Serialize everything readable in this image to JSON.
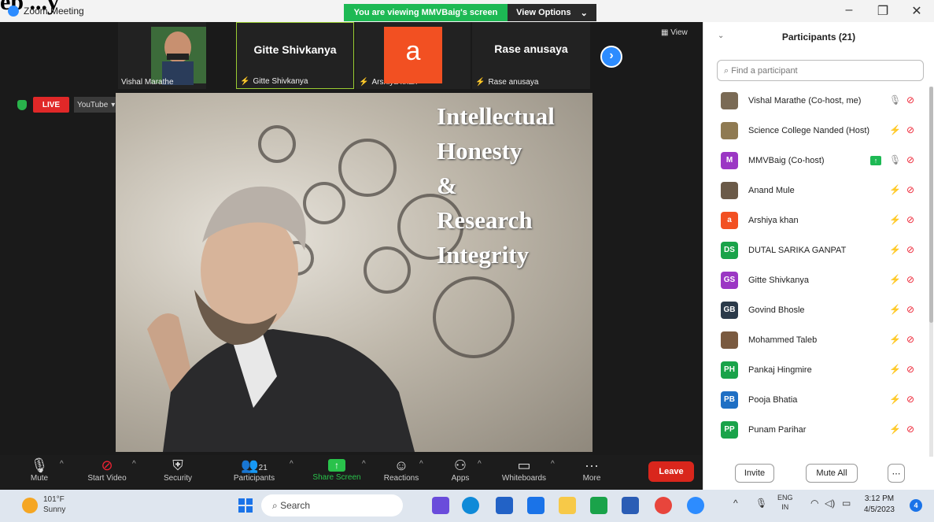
{
  "window": {
    "title": "Zoom Meeting",
    "heading_fragment": "ep ...y"
  },
  "share_banner": {
    "text": "You are viewing MMVBaig's screen",
    "view_options": "View Options"
  },
  "thumbnails": [
    {
      "name": "Vishal Marathe",
      "big": ""
    },
    {
      "name": "Gitte Shivkanya",
      "big": "Gitte Shivkanya"
    },
    {
      "name": "Arshiya khan",
      "big": "a"
    },
    {
      "name": "Rase anusaya",
      "big": "Rase anusaya"
    }
  ],
  "view_button": "View",
  "stream": {
    "live": "LIVE",
    "platform": "YouTube"
  },
  "slide": {
    "lines": [
      "Intellectual",
      "Honesty",
      "&",
      "Research",
      "Integrity"
    ]
  },
  "toolbar": {
    "mute": "Mute",
    "start_video": "Start Video",
    "security": "Security",
    "participants": "Participants",
    "participants_count": "21",
    "share_screen": "Share Screen",
    "reactions": "Reactions",
    "apps": "Apps",
    "whiteboards": "Whiteboards",
    "more": "More",
    "leave": "Leave"
  },
  "panel": {
    "title": "Participants (21)",
    "search_placeholder": "Find a participant",
    "invite": "Invite",
    "mute_all": "Mute All",
    "participants": [
      {
        "name": "Vishal Marathe (Co-host, me)",
        "initials": "",
        "color": "#7a6a55",
        "muted": false
      },
      {
        "name": "Science College Nanded (Host)",
        "initials": "",
        "color": "#8f7a52",
        "muted": true
      },
      {
        "name": "MMVBaig (Co-host)",
        "initials": "M",
        "color": "#9b37c4",
        "muted": false,
        "sharing": true
      },
      {
        "name": "Anand Mule",
        "initials": "",
        "color": "#6b5a48",
        "muted": true
      },
      {
        "name": "Arshiya khan",
        "initials": "a",
        "color": "#f25022",
        "muted": true
      },
      {
        "name": "DUTAL SARIKA GANPAT",
        "initials": "DS",
        "color": "#1aa34a",
        "muted": true
      },
      {
        "name": "Gitte Shivkanya",
        "initials": "GS",
        "color": "#9b37c4",
        "muted": true
      },
      {
        "name": "Govind Bhosle",
        "initials": "GB",
        "color": "#2b3a4a",
        "muted": true
      },
      {
        "name": "Mohammed Taleb",
        "initials": "",
        "color": "#7a5a40",
        "muted": true
      },
      {
        "name": "Pankaj Hingmire",
        "initials": "PH",
        "color": "#1aa34a",
        "muted": true
      },
      {
        "name": "Pooja Bhatia",
        "initials": "PB",
        "color": "#1f6fc4",
        "muted": true
      },
      {
        "name": "Punam Parihar",
        "initials": "PP",
        "color": "#1aa34a",
        "muted": true
      }
    ]
  },
  "taskbar": {
    "weather_temp": "101°F",
    "weather_text": "Sunny",
    "search": "Search",
    "lang_top": "ENG",
    "lang_bottom": "IN",
    "time": "3:12 PM",
    "date": "4/5/2023",
    "notifications": "4"
  }
}
